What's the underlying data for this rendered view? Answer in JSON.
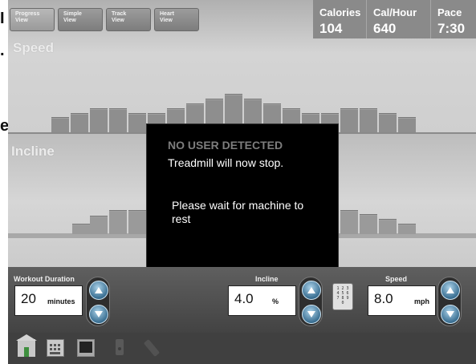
{
  "edge_fragments": [
    "I",
    ".",
    "e"
  ],
  "tabs": [
    {
      "line1": "Progress",
      "line2": "View"
    },
    {
      "line1": "Simple",
      "line2": "View"
    },
    {
      "line1": "Track",
      "line2": "View"
    },
    {
      "line1": "Heart",
      "line2": "View"
    }
  ],
  "stats": [
    {
      "label": "Calories",
      "value": "104"
    },
    {
      "label": "Cal/Hour",
      "value": "640"
    },
    {
      "label": "Pace",
      "value": "7:30"
    }
  ],
  "speed_section": {
    "label": "Speed"
  },
  "incline_section": {
    "label": "Incline"
  },
  "modal": {
    "title": "NO USER DETECTED",
    "line": "Treadmill will now stop.",
    "body": "Please wait for machine to rest"
  },
  "controls": {
    "duration": {
      "label": "Workout Duration",
      "value": "20",
      "unit": "minutes"
    },
    "incline": {
      "label": "Incline",
      "value": "4.0",
      "unit": "%"
    },
    "speed": {
      "label": "Speed",
      "value": "8.0",
      "unit": "mph"
    }
  },
  "keypad": {
    "rows": [
      "1 2 3",
      "4 5 6",
      "7 8 9",
      "0"
    ]
  },
  "toolbar": {
    "icons": [
      "home-icon",
      "keyboard-icon",
      "tv-icon",
      "ipod-icon",
      "usb-icon"
    ]
  }
}
